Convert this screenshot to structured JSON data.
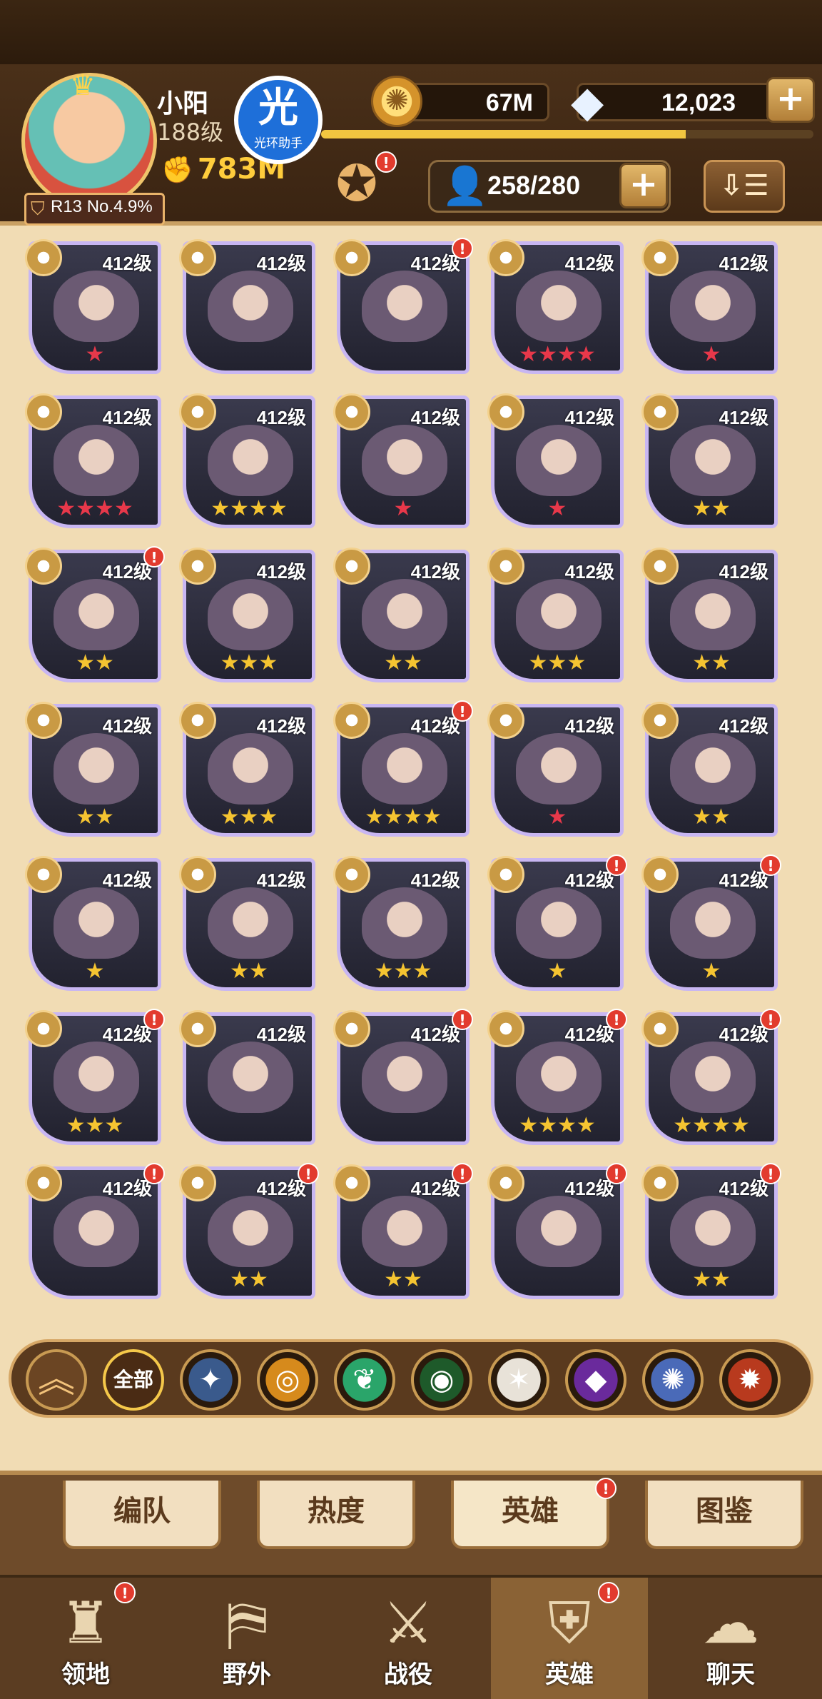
{
  "player": {
    "name": "小阳",
    "level": "188级",
    "power": "783M",
    "rank_badge": "R13 No.4.9%"
  },
  "assistant": {
    "glyph": "光",
    "label": "光环助手"
  },
  "resources": {
    "gold": "67M",
    "diamonds": "12,023"
  },
  "xp_fraction": 0.74,
  "capacity": {
    "value": "258/280"
  },
  "sort_label": "⇩☰",
  "colors": {
    "accent": "#f2c640",
    "badge": "#e23b2e",
    "card_border": "#c8b6f2",
    "star_red": "#e8384a",
    "star_gold": "#f5c431"
  },
  "heroes": [
    {
      "level": "412级",
      "stars": "★",
      "star_color": "red",
      "badge": false
    },
    {
      "level": "412级",
      "stars": "",
      "star_color": "red",
      "badge": false
    },
    {
      "level": "412级",
      "stars": "",
      "star_color": "red",
      "badge": true
    },
    {
      "level": "412级",
      "stars": "★★★★",
      "star_color": "red",
      "badge": false
    },
    {
      "level": "412级",
      "stars": "★",
      "star_color": "red",
      "badge": false
    },
    {
      "level": "412级",
      "stars": "★★★★",
      "star_color": "red",
      "badge": false
    },
    {
      "level": "412级",
      "stars": "★★★★",
      "star_color": "gold",
      "badge": false
    },
    {
      "level": "412级",
      "stars": "★",
      "star_color": "red",
      "badge": false
    },
    {
      "level": "412级",
      "stars": "★",
      "star_color": "red",
      "badge": false
    },
    {
      "level": "412级",
      "stars": "★★",
      "star_color": "gold",
      "badge": false
    },
    {
      "level": "412级",
      "stars": "★★",
      "star_color": "gold",
      "badge": true
    },
    {
      "level": "412级",
      "stars": "★★★",
      "star_color": "gold",
      "badge": false
    },
    {
      "level": "412级",
      "stars": "★★",
      "star_color": "gold",
      "badge": false
    },
    {
      "level": "412级",
      "stars": "★★★",
      "star_color": "gold",
      "badge": false
    },
    {
      "level": "412级",
      "stars": "★★",
      "star_color": "gold",
      "badge": false
    },
    {
      "level": "412级",
      "stars": "★★",
      "star_color": "gold",
      "badge": false
    },
    {
      "level": "412级",
      "stars": "★★★",
      "star_color": "gold",
      "badge": false
    },
    {
      "level": "412级",
      "stars": "★★★★",
      "star_color": "gold",
      "badge": true
    },
    {
      "level": "412级",
      "stars": "★",
      "star_color": "red",
      "badge": false
    },
    {
      "level": "412级",
      "stars": "★★",
      "star_color": "gold",
      "badge": false
    },
    {
      "level": "412级",
      "stars": "★",
      "star_color": "gold",
      "badge": false
    },
    {
      "level": "412级",
      "stars": "★★",
      "star_color": "gold",
      "badge": false
    },
    {
      "level": "412级",
      "stars": "★★★",
      "star_color": "gold",
      "badge": false
    },
    {
      "level": "412级",
      "stars": "★",
      "star_color": "gold",
      "badge": true
    },
    {
      "level": "412级",
      "stars": "★",
      "star_color": "gold",
      "badge": true
    },
    {
      "level": "412级",
      "stars": "★★★",
      "star_color": "gold",
      "badge": true
    },
    {
      "level": "412级",
      "stars": "",
      "star_color": "gold",
      "badge": false
    },
    {
      "level": "412级",
      "stars": "",
      "star_color": "gold",
      "badge": true
    },
    {
      "level": "412级",
      "stars": "★★★★",
      "star_color": "gold",
      "badge": true
    },
    {
      "level": "412级",
      "stars": "★★★★",
      "star_color": "gold",
      "badge": true
    },
    {
      "level": "412级",
      "stars": "",
      "star_color": "gold",
      "badge": true
    },
    {
      "level": "412级",
      "stars": "★★",
      "star_color": "gold",
      "badge": true
    },
    {
      "level": "412级",
      "stars": "★★",
      "star_color": "gold",
      "badge": true
    },
    {
      "level": "412级",
      "stars": "",
      "star_color": "gold",
      "badge": true
    },
    {
      "level": "412级",
      "stars": "★★",
      "star_color": "gold",
      "badge": true
    }
  ],
  "faction_filters": [
    {
      "name": "lightbearer",
      "color": "#3a5a8c",
      "glyph": "✦"
    },
    {
      "name": "mauler",
      "color": "#d68a1c",
      "glyph": "◎"
    },
    {
      "name": "wilder",
      "color": "#2aa56a",
      "glyph": "❦"
    },
    {
      "name": "graveborn",
      "color": "#1e5a2a",
      "glyph": "◉"
    },
    {
      "name": "celestial",
      "color": "#e8e2d8",
      "glyph": "✶"
    },
    {
      "name": "hypogean",
      "color": "#6a2a9c",
      "glyph": "◆"
    },
    {
      "name": "dimensional",
      "color": "#4a6ab8",
      "glyph": "✺"
    },
    {
      "name": "draconis",
      "color": "#b83a1e",
      "glyph": "✹"
    }
  ],
  "filters": {
    "all_label": "全部",
    "up_glyph": "︽"
  },
  "tabs": [
    {
      "label": "编队",
      "badge": false
    },
    {
      "label": "热度",
      "badge": false
    },
    {
      "label": "英雄",
      "badge": true
    },
    {
      "label": "图鉴",
      "badge": false
    }
  ],
  "nav": [
    {
      "label": "领地",
      "icon": "castle-icon",
      "glyph": "♜",
      "badge": true
    },
    {
      "label": "野外",
      "icon": "map-scroll-icon",
      "glyph": "⛿",
      "badge": false
    },
    {
      "label": "战役",
      "icon": "sword-icon",
      "glyph": "⚔",
      "badge": false
    },
    {
      "label": "英雄",
      "icon": "hero-helmet-icon",
      "glyph": "⛨",
      "badge": true
    },
    {
      "label": "聊天",
      "icon": "chat-icon",
      "glyph": "☁",
      "badge": false
    }
  ]
}
